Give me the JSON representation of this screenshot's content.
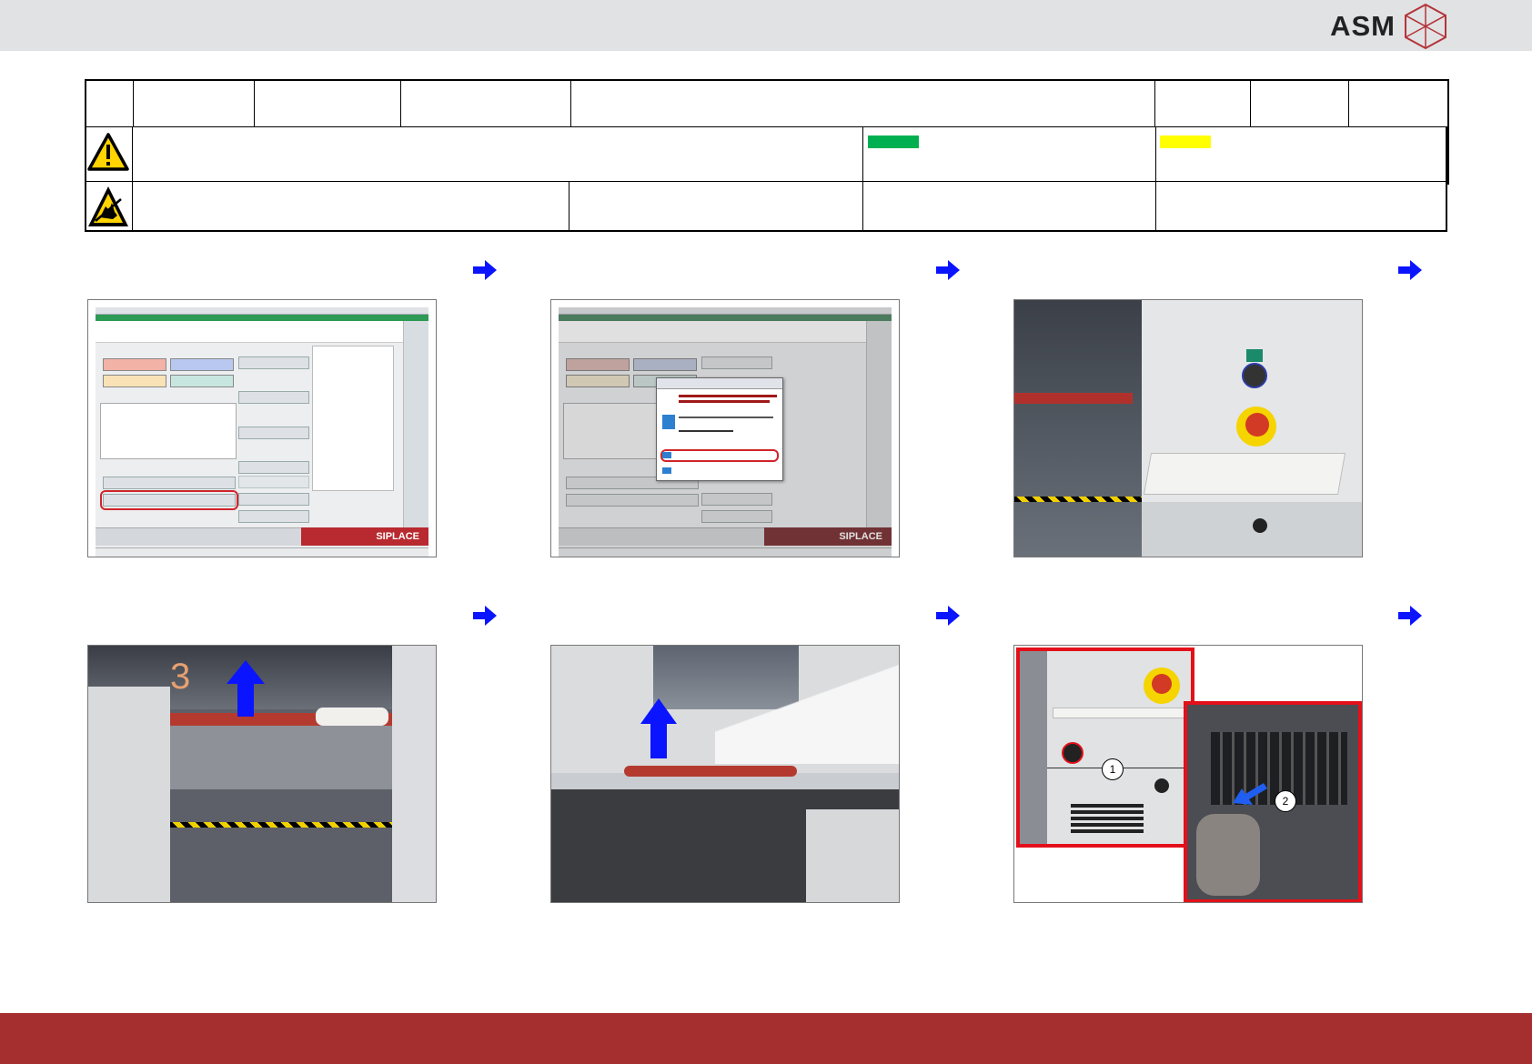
{
  "header": {
    "logo_text": "ASM",
    "accent_color": "#a52e2e",
    "topbar_color": "#e1e2e4"
  },
  "legend": {
    "green_swatch": "#00b050",
    "yellow_swatch": "#ffff00"
  },
  "icons": {
    "warning": "warning-triangle-icon",
    "esd": "esd-hand-icon",
    "arrow": "arrow-right-icon"
  },
  "screens": {
    "brand": "SIPLACE"
  }
}
